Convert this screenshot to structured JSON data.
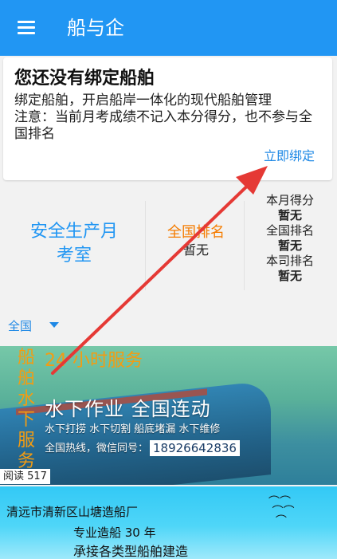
{
  "header": {
    "title": "船与企"
  },
  "card": {
    "title": "您还没有绑定船舶",
    "description": "绑定船舶，开启船岸一体化的现代船舶管理\n注意：当前月考成绩不记入本分得分，也不参与全国排名",
    "bind_link": "立即绑定"
  },
  "stats": {
    "safety_title": "安全生产月\n考室",
    "rank_label": "全国排名",
    "rank_value": "暂无",
    "month_score_label": "本月得分",
    "month_score_value": "暂无",
    "national_rank_label": "全国排名",
    "national_rank_value": "暂无",
    "company_rank_label": "本司排名",
    "company_rank_value": "暂无"
  },
  "filter": {
    "region": "全国"
  },
  "banner1": {
    "vertical_text": "船舶水下服务",
    "headline": "24 小时服务",
    "main": "水下作业  全国连动",
    "services": "水下打捞  水下切割  船底堵漏  水下维修",
    "hotline_label": "全国热线，微信同号：",
    "phone": "18926642836",
    "read_count": "阅读 517"
  },
  "banner2": {
    "company": "清远市清新区山塘造船厂",
    "line1": "专业造船 30 年",
    "line2": "承接各类型船舶建造"
  },
  "colors": {
    "primary": "#2196f3",
    "accent_orange": "#f57c00",
    "link": "#1e88e5",
    "annotation_red": "#e53935"
  }
}
